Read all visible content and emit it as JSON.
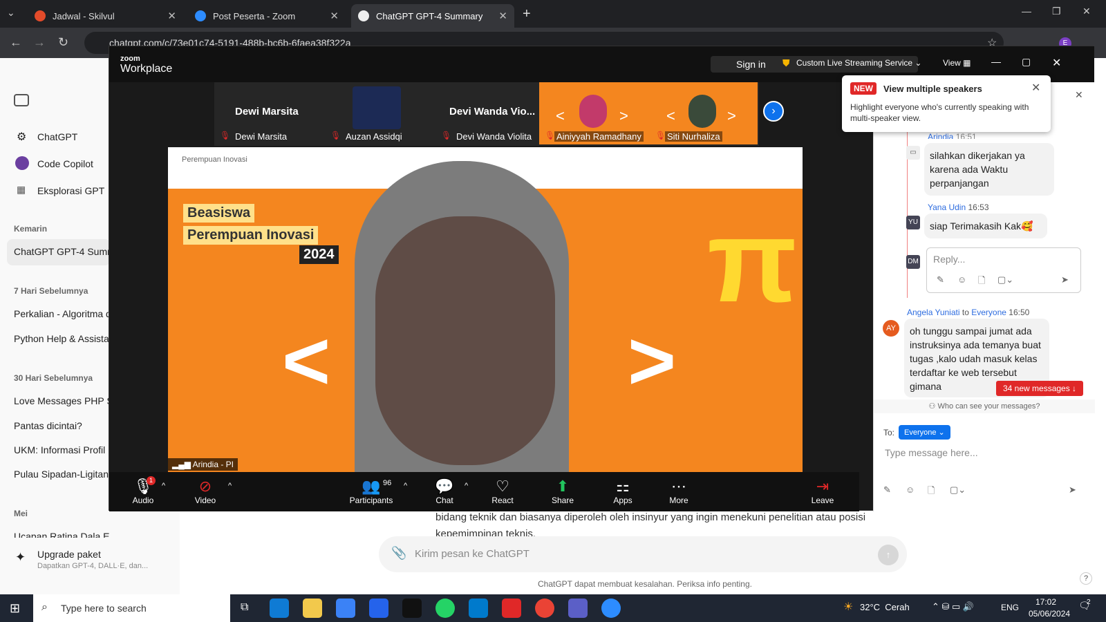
{
  "browser": {
    "tabs": [
      {
        "title": "Jadwal - Skilvul",
        "color": "#e34b2a"
      },
      {
        "title": "Post Peserta - Zoom",
        "color": "#2d8cff"
      },
      {
        "title": "ChatGPT GPT-4 Summary",
        "color": "#ddd"
      }
    ],
    "url": "chatgpt.com/c/73e01c74-5191-488b-bc6b-6faea38f322a"
  },
  "chatgpt": {
    "sidebar": {
      "items": [
        {
          "label": "ChatGPT"
        },
        {
          "label": "Code Copilot"
        },
        {
          "label": "Eksplorasi GPT"
        }
      ],
      "sections": [
        {
          "heading": "Kemarin",
          "items": [
            "ChatGPT GPT-4 Summ"
          ]
        },
        {
          "heading": "7 Hari Sebelumnya",
          "items": [
            "Perkalian - Algoritma d",
            "Python Help & Assista"
          ]
        },
        {
          "heading": "30 Hari Sebelumnya",
          "items": [
            "Love Messages PHP So",
            "Pantas dicintai?",
            "UKM: Informasi Profil I",
            "Pulau Sipadan-Ligitan:"
          ]
        },
        {
          "heading": "Mei",
          "items": [
            "Ucapan Ratina Dala E"
          ]
        }
      ],
      "upgrade_title": "Upgrade paket",
      "upgrade_sub": "Dapatkan GPT-4, DALL·E, dan..."
    },
    "content_line1": "bidang teknik dan biasanya diperoleh oleh insinyur yang ingin menekuni penelitian atau posisi",
    "content_line2": "kepemimpinan teknis.",
    "prompt_placeholder": "Kirim pesan ke ChatGPT",
    "footer": "ChatGPT dapat membuat kesalahan. Periksa info penting.",
    "help": "?"
  },
  "zoom": {
    "brand_top": "zoom",
    "brand": "Workplace",
    "sign_in": "Sign in",
    "streaming": "Custom Live Streaming Service",
    "view": "View",
    "participants": [
      {
        "tile_name": "Dewi Marsita",
        "label": "Dewi Marsita"
      },
      {
        "tile_name": "",
        "label": "Auzan Assidqi"
      },
      {
        "tile_name": "Devi Wanda Vio...",
        "label": "Devi Wanda Violita"
      },
      {
        "tile_name": "",
        "label": "Ainiyyah Ramadhany"
      },
      {
        "tile_name": "",
        "label": "Siti Nurhaliza"
      }
    ],
    "video": {
      "speaker_label": "Arindia - PI",
      "banner_line1": "Beasiswa",
      "banner_line2": "Perempuan Inovasi",
      "banner_year": "2024",
      "logo_text": "Perempuan Inovasi"
    },
    "toolbar": {
      "audio": "Audio",
      "audio_badge": "1",
      "video": "Video",
      "participants": "Participants",
      "participant_count": "96",
      "chat": "Chat",
      "react": "React",
      "share": "Share",
      "apps": "Apps",
      "more": "More",
      "leave": "Leave"
    },
    "popup": {
      "badge": "NEW",
      "title": "View multiple speakers",
      "body": "Highlight everyone who's currently speaking with multi-speaker view."
    },
    "chat": {
      "thread_top_name": "Arindia",
      "thread_top_time": "16:51",
      "msg1": "silahkan dikerjakan ya karena ada Waktu perpanjangan",
      "yana_name": "Yana Udin",
      "yana_time": "16:53",
      "yana_initials": "YU",
      "msg2": "siap Terimakasih Kak🥰",
      "reply_initials": "DM",
      "reply_placeholder": "Reply...",
      "angela_name": "Angela Yuniati",
      "angela_to": "to",
      "angela_target": "Everyone",
      "angela_time": "16:50",
      "angela_initials": "AY",
      "msg3": "oh tunggu sampai jumat ada instruksinya ada temanya buat tugas ,kalo udah masuk kelas terdaftar ke web tersebut gimana",
      "new_messages": "34 new messages ↓",
      "who_can_see": "Who can see your messages?",
      "to_label": "To:",
      "to_target": "Everyone",
      "input_placeholder": "Type message here..."
    }
  },
  "taskbar": {
    "search": "Type here to search",
    "weather": "32°C  Cerah",
    "lang": "ENG",
    "time": "17:02",
    "date": "05/06/2024",
    "notif": "2"
  }
}
